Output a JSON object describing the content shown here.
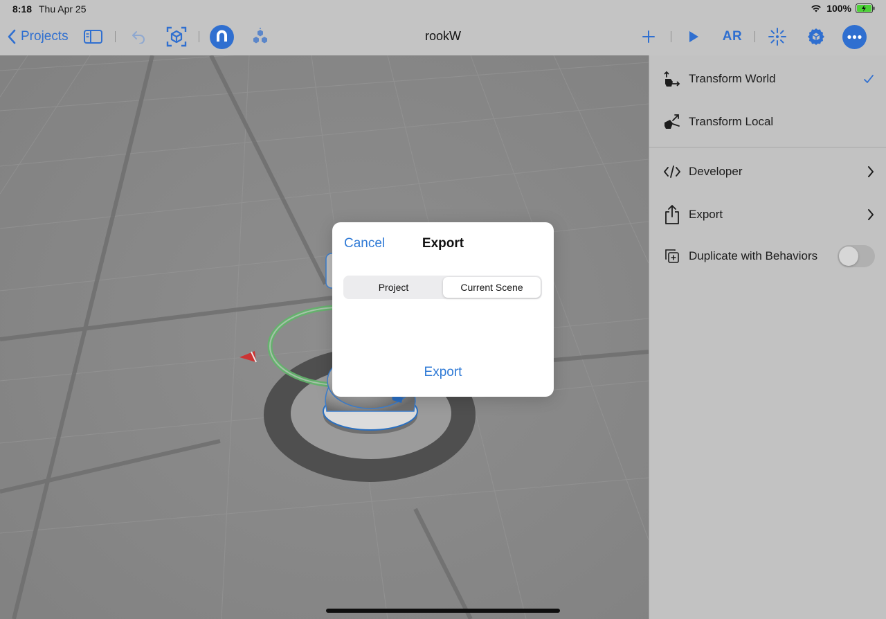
{
  "status_bar": {
    "time": "8:18",
    "date": "Thu Apr 25",
    "battery": "100%"
  },
  "toolbar": {
    "back_label": "Projects",
    "title": "rookW",
    "ar_label": "AR"
  },
  "menu": {
    "items": [
      {
        "label": "Transform World",
        "icon": "transform-world-icon",
        "trailing": "checkmark"
      },
      {
        "label": "Transform Local",
        "icon": "transform-local-icon",
        "trailing": ""
      },
      {
        "label": "Developer",
        "icon": "code-icon",
        "trailing": "chevron"
      },
      {
        "label": "Export",
        "icon": "share-icon",
        "trailing": "chevron"
      },
      {
        "label": "Duplicate with Behaviors",
        "icon": "duplicate-icon",
        "trailing": "toggle"
      }
    ],
    "duplicate_toggle_on": false
  },
  "dialog": {
    "cancel_label": "Cancel",
    "title": "Export",
    "segments": [
      "Project",
      "Current Scene"
    ],
    "selected_segment": "Current Scene",
    "export_label": "Export"
  },
  "colors": {
    "accent": "#2f7ad6",
    "toolbar": "#c4c4c4",
    "panel": "#c2c2c2"
  }
}
